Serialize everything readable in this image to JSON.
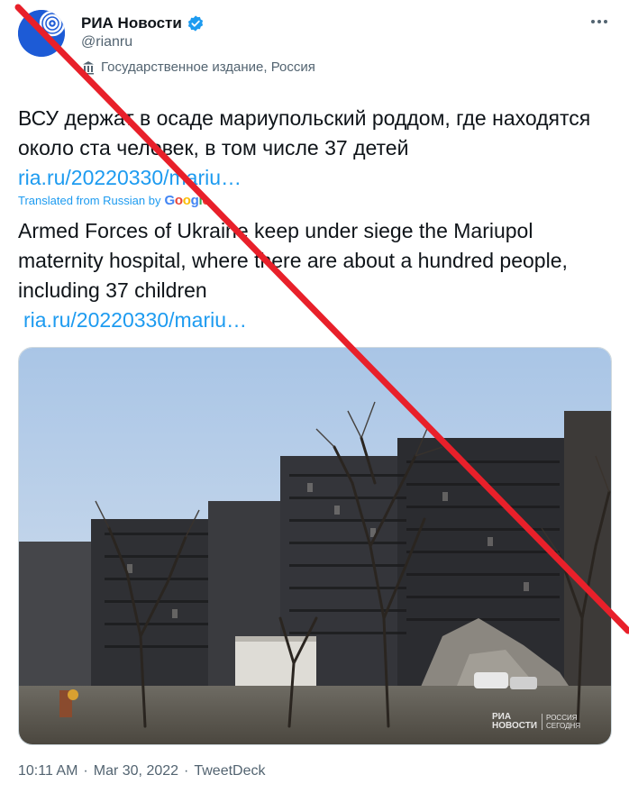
{
  "account": {
    "display_name": "РИА Новости",
    "handle": "@rianru",
    "label": "Государственное издание, Россия",
    "verified_icon": "verified-badge-icon",
    "avatar_color": "#1d5bd6"
  },
  "tweet": {
    "text": "ВСУ держат в осаде мариупольский роддом, где находятся около ста человек, в том числе 37 детей",
    "link": "ria.ru/20220330/mariu…",
    "translated_label": "Translated from Russian by",
    "translator": "Google",
    "translation_text": "Armed Forces of Ukraine keep under siege the Mariupol maternity hospital, where there are about a hundred people, including 37 children",
    "translation_link": "ria.ru/20220330/mariu…"
  },
  "media": {
    "watermark_line1": "РИА",
    "watermark_line2": "НОВОСТИ",
    "watermark_line3": "РОССИЯ",
    "watermark_line4": "СЕГОДНЯ"
  },
  "meta": {
    "time": "10:11 AM",
    "separator1": "·",
    "date": "Mar 30, 2022",
    "separator2": "·",
    "source": "TweetDeck"
  },
  "colors": {
    "link": "#1d9bf0",
    "cross": "#e8202a",
    "secondary_text": "#536471"
  }
}
